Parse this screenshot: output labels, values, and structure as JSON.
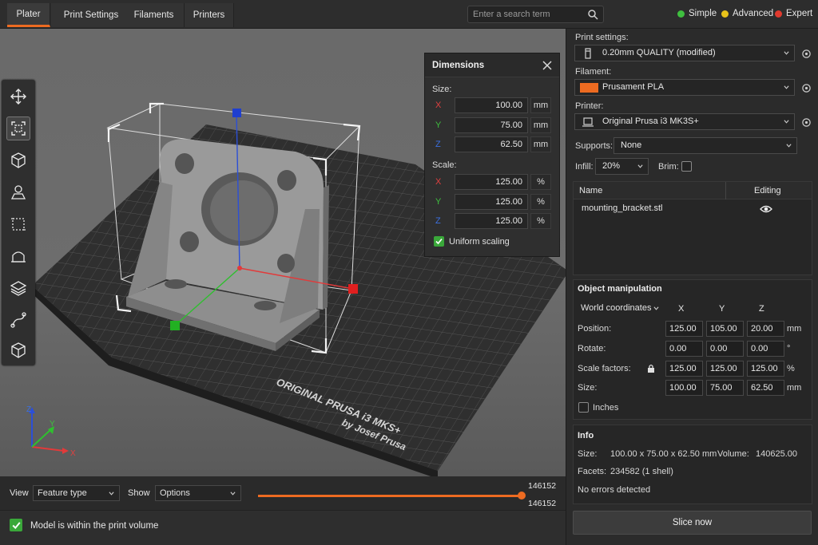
{
  "tabs": [
    {
      "label": "Plater",
      "active": true
    },
    {
      "label": "Print Settings",
      "active": false
    },
    {
      "label": "Filaments",
      "active": false
    },
    {
      "label": "Printers",
      "active": false
    }
  ],
  "search": {
    "placeholder": "Enter a search term"
  },
  "modes": [
    {
      "label": "Simple",
      "color": "#3fbf3f"
    },
    {
      "label": "Advanced",
      "color": "#e8c21a"
    },
    {
      "label": "Expert",
      "color": "#e03a2e"
    }
  ],
  "toolbar_tools": [
    "move-icon",
    "scale-icon",
    "rotate-icon",
    "place-on-face-icon",
    "cut-icon",
    "paint-supports-icon",
    "seam-icon",
    "mmu-paint-icon",
    "measure-icon"
  ],
  "dimensions": {
    "title": "Dimensions",
    "size_label": "Size:",
    "scale_label": "Scale:",
    "size": [
      {
        "axis": "X",
        "value": "100.00",
        "unit": "mm",
        "color": "#e04040"
      },
      {
        "axis": "Y",
        "value": "75.00",
        "unit": "mm",
        "color": "#3fbf3f"
      },
      {
        "axis": "Z",
        "value": "62.50",
        "unit": "mm",
        "color": "#3b6fe0"
      }
    ],
    "scale": [
      {
        "axis": "X",
        "value": "125.00",
        "unit": "%",
        "color": "#e04040"
      },
      {
        "axis": "Y",
        "value": "125.00",
        "unit": "%",
        "color": "#3fbf3f"
      },
      {
        "axis": "Z",
        "value": "125.00",
        "unit": "%",
        "color": "#3b6fe0"
      }
    ],
    "uniform_label": "Uniform scaling",
    "uniform_checked": true
  },
  "bed": {
    "line1": "ORIGINAL PRUSA i3 MKS+",
    "line2": "by Josef Prusa"
  },
  "axes_gizmo": {
    "x": "X",
    "y": "Y",
    "z": "Z"
  },
  "bottom": {
    "view_label": "View",
    "view_value": "Feature type",
    "show_label": "Show",
    "show_value": "Options",
    "layer_top": "146152",
    "layer_bottom": "146152",
    "status": "Model is within the print volume"
  },
  "right": {
    "print_settings_label": "Print settings:",
    "print_settings_value": "0.20mm QUALITY (modified)",
    "filament_label": "Filament:",
    "filament_value": "Prusament PLA",
    "filament_color": "#ed6b21",
    "printer_label": "Printer:",
    "printer_value": "Original Prusa i3 MK3S+",
    "supports_label": "Supports:",
    "supports_value": "None",
    "infill_label": "Infill:",
    "infill_value": "20%",
    "brim_label": "Brim:",
    "table": {
      "col_name": "Name",
      "col_editing": "Editing",
      "rows": [
        {
          "name": "mounting_bracket.stl"
        }
      ]
    },
    "object_manipulation": {
      "title": "Object manipulation",
      "coords": "World coordinates",
      "axes": [
        "X",
        "Y",
        "Z"
      ],
      "rows": [
        {
          "label": "Position:",
          "values": [
            "125.00",
            "105.00",
            "20.00"
          ],
          "unit": "mm"
        },
        {
          "label": "Rotate:",
          "values": [
            "0.00",
            "0.00",
            "0.00"
          ],
          "unit": "°"
        },
        {
          "label": "Scale factors:",
          "values": [
            "125.00",
            "125.00",
            "125.00"
          ],
          "unit": "%"
        },
        {
          "label": "Size:",
          "values": [
            "100.00",
            "75.00",
            "62.50"
          ],
          "unit": "mm"
        }
      ],
      "inches_label": "Inches"
    },
    "info": {
      "title": "Info",
      "size_label": "Size:",
      "size_value": "100.00 x 75.00 x 62.50 mm",
      "volume_label": "Volume:",
      "volume_value": "140625.00",
      "facets_label": "Facets:",
      "facets_value": "234582 (1 shell)",
      "errors": "No errors detected"
    },
    "slice_label": "Slice now"
  }
}
